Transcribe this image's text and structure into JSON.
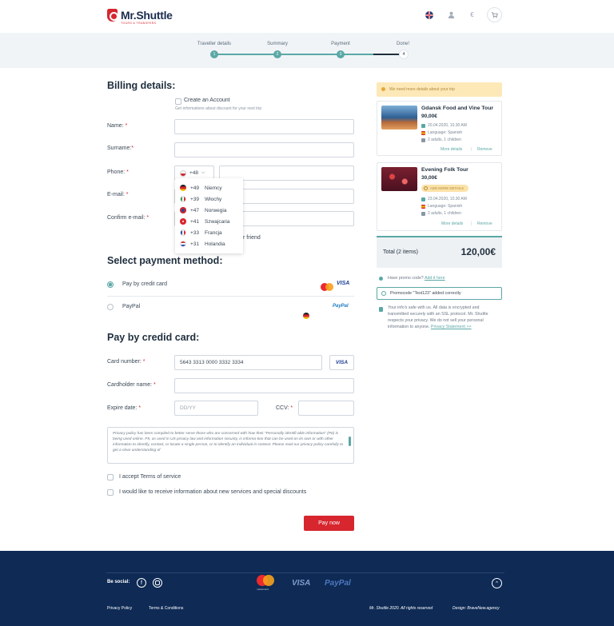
{
  "header": {
    "brand": "Mr.Shuttle",
    "brand_sub": "TOURS & TRANSFERS",
    "currency": "€"
  },
  "steps": [
    "Traveller details",
    "Summary",
    "Payment",
    "Done!"
  ],
  "step_numbers": [
    "1",
    "2",
    "3",
    "4"
  ],
  "billing": {
    "title": "Billing details:",
    "create_account": "Create an Account",
    "create_hint": "Get informations about discount for your next trip",
    "name_label": "Name:",
    "surname_label": "Surname:",
    "phone_label": "Phone:",
    "email_label": "E-mail:",
    "confirm_label": "Confirm e-mail:",
    "phone_prefix": "+48",
    "friend_text": "r friend"
  },
  "countries": [
    {
      "code": "+49",
      "name": "Niemcy",
      "color": "#333"
    },
    {
      "code": "+39",
      "name": "Włochy",
      "color": "#2a9d4b"
    },
    {
      "code": "+47",
      "name": "Norwegia",
      "color": "#2a4a8a"
    },
    {
      "code": "+41",
      "name": "Szwajcaria",
      "color": "#d7262e"
    },
    {
      "code": "+33",
      "name": "Francja",
      "color": "#2a4aa8"
    },
    {
      "code": "+31",
      "name": "Holandia",
      "color": "#c83a3a"
    }
  ],
  "payment_method": {
    "title": "Select payment method:",
    "card": "Pay by credit card",
    "paypal": "PayPal",
    "visa": "VISA",
    "paypal_logo": "PayPal"
  },
  "card": {
    "title": "Pay by credid card:",
    "number_label": "Card number:",
    "number_value": "5643 3313 0000 3332 3334",
    "visa": "VISA",
    "holder_label": "Cardholder name:",
    "expire_label": "Expire date:",
    "expire_ph": "DD/YY",
    "ccv_label": "CCV:",
    "policy": "Privacy policy has been compiled to better serve those who are concerned with how their \"Personally identifi-able information\" (PII) is being used online. PII, as used in US privacy law and information security, is informa-tion that can be used on its own or with other information to identify, contact, or locate a single person, or to identify an individual in context. Please read our privacy policy carefully to get a clear understanding of",
    "terms": "I accept Terms of service",
    "newsletter": "I would like to receive information about new services and special discounts",
    "pay_button": "Pay now"
  },
  "sidebar": {
    "alert": "We need more details about your trip",
    "tours": [
      {
        "title": "Gdansk Food and Vine Tour",
        "price": "90,00€",
        "date": "20.04.2020, 10.30 AM",
        "lang": "Language: Spanish",
        "people": "2 adults, 1 children",
        "badge": ""
      },
      {
        "title": "Evening Folk Tour",
        "price": "30,00€",
        "date": "23.04.2020, 10.30 AM",
        "lang": "Language: Spanish",
        "people": "2 adults, 1 children",
        "badge": "ADD MORE DETAILS"
      }
    ],
    "more_details": "More details",
    "remove": "Remove",
    "total_label": "Total (2 items)",
    "total_value": "120,00€",
    "promo_q": "Have promo code?",
    "promo_link": "Add it here",
    "promo_applied": "Promocode \"Test123\" added correctly",
    "secure_text": "Your info's safe with us. All data is encrypted and transmitted securely with an SSL protocol. Mr. Shuttle respects your privacy. We do not sell your personal information to anyone.",
    "privacy_link": "Privacy Statement >>"
  },
  "footer": {
    "social": "Be social:",
    "privacy": "Privacy Policy",
    "terms": "Terms & Conditions",
    "visa": "VISA",
    "paypal": "PayPal",
    "mastercard": "mastercard",
    "rights": "Mr. Shuttle 2020. All rights reserved",
    "design": "Design: BraveNew.agency"
  }
}
